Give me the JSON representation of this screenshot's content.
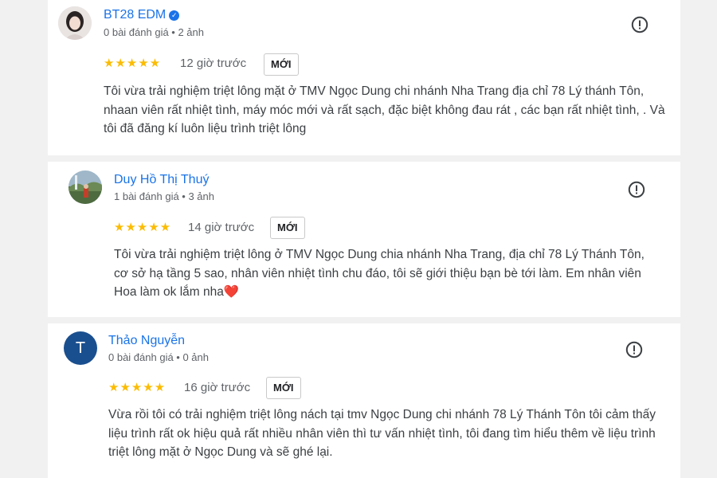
{
  "reviews": [
    {
      "name": "BT28 EDM",
      "verified": true,
      "meta": "0 bài đánh giá • 2 ảnh",
      "stars": "★★★★★",
      "rating": 5,
      "time": "12 giờ trước",
      "badge": "MỚI",
      "text": "Tôi vừa trải nghiệm triệt lông mặt ở TMV Ngọc Dung chi nhánh Nha Trang địa chỉ 78 Lý thánh Tôn, nhaan viên rất nhiệt tình, máy móc mới và rất sạch, đặc biệt không đau rát , các bạn rất nhiệt tình, . Và tôi đã đăng kí luôn liệu trình triệt lông"
    },
    {
      "name": "Duy Hồ Thị Thuý",
      "verified": false,
      "meta": "1 bài đánh giá • 3 ảnh",
      "stars": "★★★★★",
      "rating": 5,
      "time": "14 giờ trước",
      "badge": "MỚI",
      "text": "Tôi vừa trải nghiệm triệt lông ở TMV Ngọc Dung chia nhánh Nha Trang, địa chỉ 78 Lý Thánh Tôn, cơ sở hạ tầng 5 sao, nhân viên nhiệt tình chu đáo, tôi sẽ giới thiệu bạn bè tới làm. Em nhân viên Hoa làm ok lắm nha❤️"
    },
    {
      "name": "Thảo Nguyễn",
      "avatar_letter": "T",
      "verified": false,
      "meta": "0 bài đánh giá • 0 ảnh",
      "stars": "★★★★★",
      "rating": 5,
      "time": "16 giờ trước",
      "badge": "MỚI",
      "text": "Vừa rồi tôi có trải nghiệm triệt lông nách tại tmv Ngọc Dung chi nhánh 78 Lý Thánh Tôn tôi cảm thấy liệu trình rất ok hiệu quả rất nhiều nhân viên thì tư vấn nhiệt tình, tôi đang tìm hiểu thêm về liệu trình triệt lông mặt ở Ngọc Dung và sẽ ghé lại."
    }
  ],
  "colors": {
    "name_link": "#1a73e8",
    "star": "#fbbc04",
    "avatar_bg": "#1a4f8f",
    "page_bg": "#f1f1f1"
  },
  "icons": {
    "verified": "verified-check-icon",
    "report": "report-exclamation-icon"
  }
}
